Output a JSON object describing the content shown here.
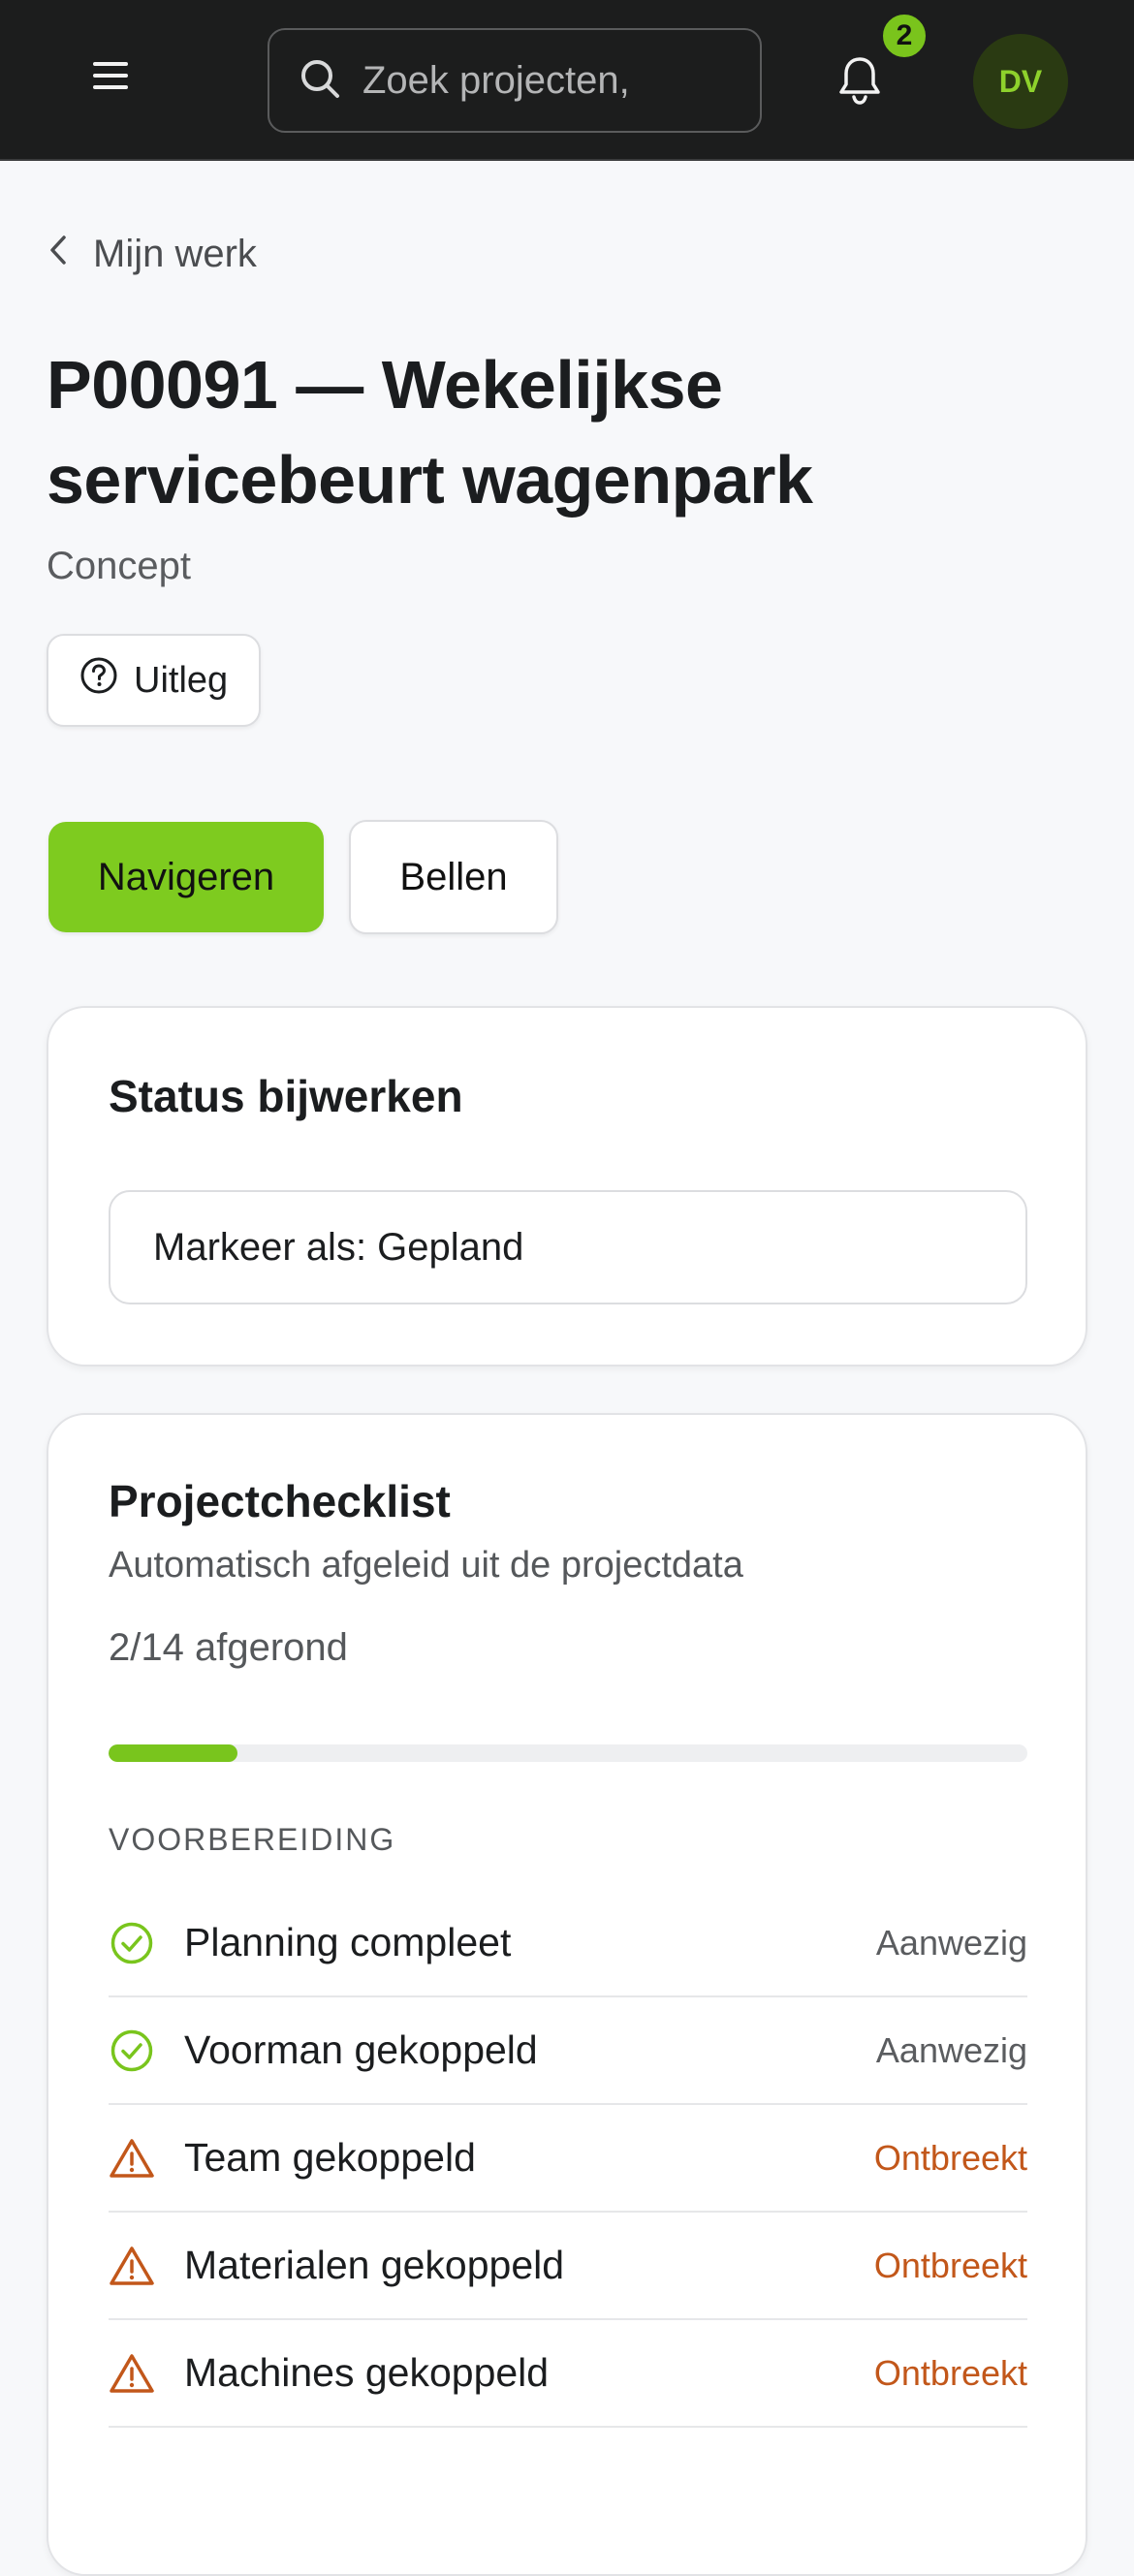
{
  "header": {
    "search_placeholder": "Zoek projecten,",
    "notification_count": "2",
    "avatar_initials": "DV"
  },
  "breadcrumb": {
    "back_label": "Mijn werk"
  },
  "project": {
    "title": "P00091 — Wekelijkse servicebeurt wagenpark",
    "status": "Concept"
  },
  "actions": {
    "uitleg_label": "Uitleg",
    "navigate_label": "Navigeren",
    "call_label": "Bellen"
  },
  "status_card": {
    "title": "Status bijwerken",
    "mark_label": "Markeer als: Gepland"
  },
  "checklist": {
    "title": "Projectchecklist",
    "subtitle": "Automatisch afgeleid uit de projectdata",
    "progress_text": "2/14 afgerond",
    "progress_fraction": 0.14,
    "section_label": "VOORBEREIDING",
    "items": [
      {
        "label": "Planning compleet",
        "state": "Aanwezig",
        "ok": true
      },
      {
        "label": "Voorman gekoppeld",
        "state": "Aanwezig",
        "ok": true
      },
      {
        "label": "Team gekoppeld",
        "state": "Ontbreekt",
        "ok": false
      },
      {
        "label": "Materialen gekoppeld",
        "state": "Ontbreekt",
        "ok": false
      },
      {
        "label": "Machines gekoppeld",
        "state": "Ontbreekt",
        "ok": false
      }
    ]
  },
  "colors": {
    "accent": "#7ecb1f",
    "ok": "#79c51d",
    "missing": "#c2571a",
    "topbar": "#1c1d1d"
  }
}
